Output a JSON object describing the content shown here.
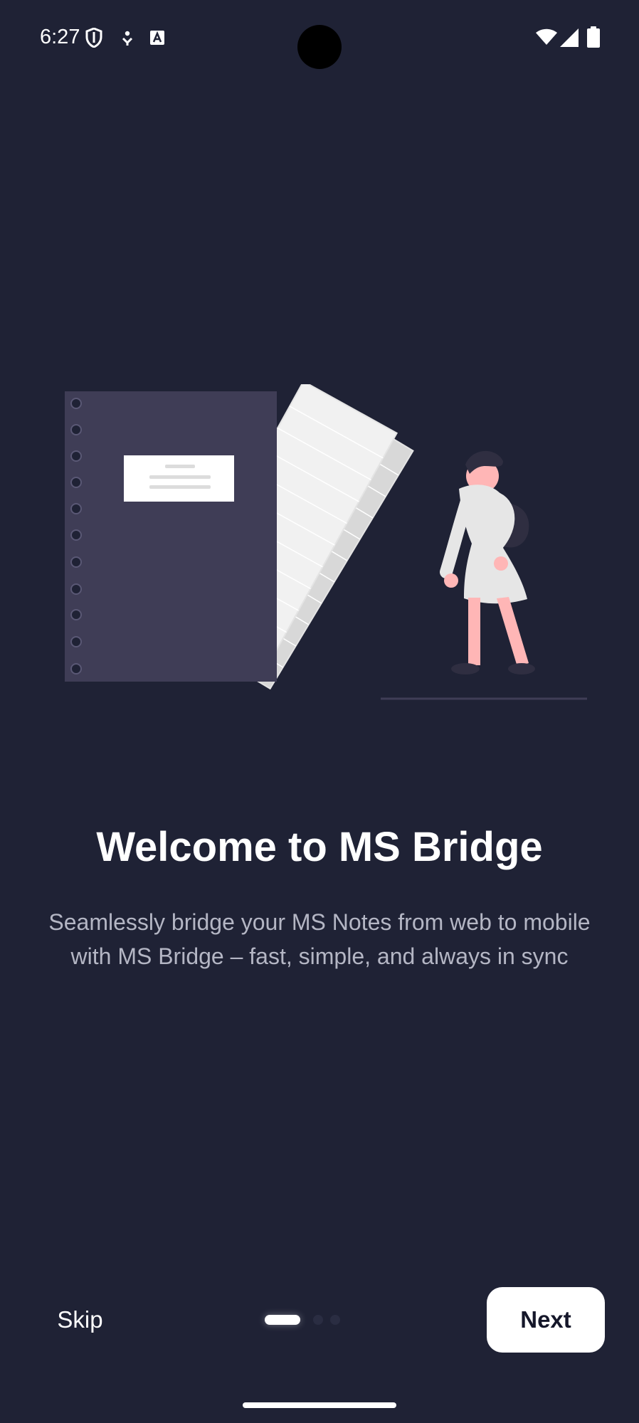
{
  "status_bar": {
    "time": "6:27",
    "icons": [
      "shield-icon",
      "activity-icon",
      "accessibility-icon",
      "wifi-icon",
      "cell-signal-icon",
      "battery-icon"
    ]
  },
  "illustration": {
    "name": "notebook-and-woman-illustration",
    "colors": {
      "background": "#1f2235",
      "notebook": "#3f3d56",
      "paper": "#f1f1f1",
      "skin": "#ffb6b6",
      "hair": "#2f2e41"
    }
  },
  "onboarding": {
    "title": "Welcome to MS Bridge",
    "description": "Seamlessly bridge your MS Notes from web to mobile with MS Bridge – fast, simple, and always in sync",
    "current_page": 1,
    "total_pages": 3
  },
  "actions": {
    "skip_label": "Skip",
    "next_label": "Next"
  },
  "theme": {
    "background": "#1f2235",
    "primary_text": "#ffffff",
    "secondary_text": "#b4b6c4",
    "button_background": "#ffffff",
    "button_text": "#15172a"
  }
}
